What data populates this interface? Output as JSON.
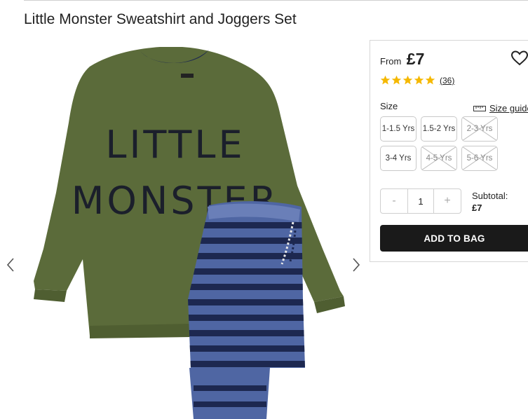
{
  "product": {
    "title": "Little Monster Sweatshirt and Joggers Set",
    "print_text_line1": "LITTLE",
    "print_text_line2": "MONSTER",
    "label_text": "George"
  },
  "price": {
    "from_label": "From",
    "value": "£7"
  },
  "rating": {
    "stars": 5,
    "max": 5,
    "reviews_count": "(36)",
    "star_color": "#f5b800"
  },
  "size": {
    "label": "Size",
    "guide_label": "Size guide",
    "options": [
      {
        "label": "1-1.5 Yrs",
        "available": true
      },
      {
        "label": "1.5-2 Yrs",
        "available": true
      },
      {
        "label": "2-3 Yrs",
        "available": false
      },
      {
        "label": "3-4 Yrs",
        "available": true
      },
      {
        "label": "4-5 Yrs",
        "available": false
      },
      {
        "label": "5-6 Yrs",
        "available": false
      }
    ]
  },
  "quantity": {
    "minus": "-",
    "value": "1",
    "plus": "+"
  },
  "subtotal": {
    "label": "Subtotal:",
    "value": "£7"
  },
  "cta": {
    "add_to_bag": "ADD TO BAG"
  },
  "colors": {
    "sweatshirt": "#5b6b3a",
    "joggers": "#4f66a3",
    "stripe": "#1d2850",
    "button_bg": "#1a1a1a"
  }
}
